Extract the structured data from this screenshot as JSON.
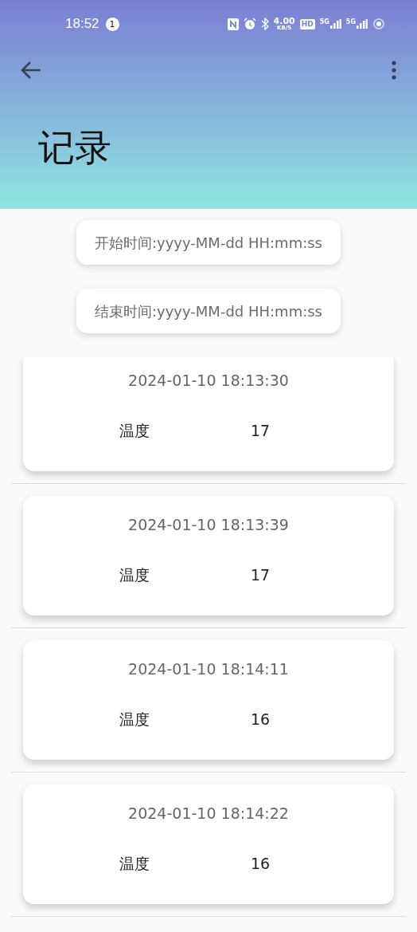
{
  "status_bar": {
    "time": "18:52",
    "notification_count": "1",
    "speed_value": "4.00",
    "speed_unit": "KB/S",
    "hd_label": "HD",
    "signals": [
      "5G",
      "5G"
    ]
  },
  "app_bar": {
    "title": "记录"
  },
  "filters": [
    {
      "placeholder": "开始时间:yyyy-MM-dd HH:mm:ss"
    },
    {
      "placeholder": "结束时间:yyyy-MM-dd HH:mm:ss"
    }
  ],
  "records": [
    {
      "time": "2024-01-10 18:13:30",
      "label": "温度",
      "value": "17"
    },
    {
      "time": "2024-01-10 18:13:39",
      "label": "温度",
      "value": "17"
    },
    {
      "time": "2024-01-10 18:14:11",
      "label": "温度",
      "value": "16"
    },
    {
      "time": "2024-01-10 18:14:22",
      "label": "温度",
      "value": "16"
    }
  ]
}
